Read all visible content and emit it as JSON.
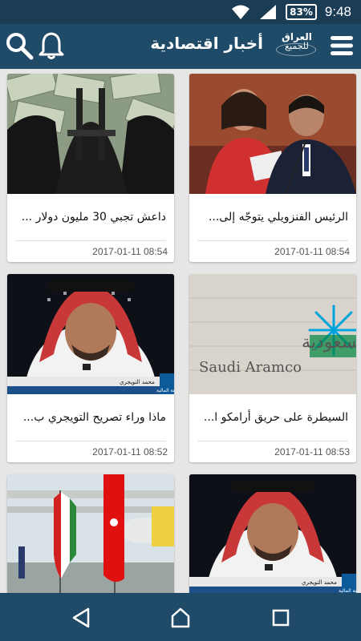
{
  "statusbar": {
    "battery": "83%",
    "time": "9:48"
  },
  "appbar": {
    "title": "أخبار اقتصادية",
    "logo_line1": "العراق",
    "logo_line2": "للجميع"
  },
  "cards": [
    {
      "title": "الرئيس الفنزويلي يتوجّه إلى...",
      "date": "2017-01-11 08:54"
    },
    {
      "title": "داعش تجبي 30 مليون دولار ...",
      "date": "2017-01-11 08:54"
    },
    {
      "title": "السيطرة على حريق أرامكو ا...",
      "date": "2017-01-11 08:53"
    },
    {
      "title": "ماذا وراء تصريح التويجري ب...",
      "date": "2017-01-11 08:52"
    }
  ],
  "images": {
    "aramco_text_ar": "ارامكو السعودية",
    "aramco_text_en": "Saudi Aramco",
    "tv_caption_name": "محمد التويجري",
    "tv_caption_role": "نائب وزير الاقتصاد والتخطيط وأمين عام اللجنة المالية"
  },
  "colors": {
    "appbar": "#1f4a68",
    "statusbar": "#1a3d55",
    "background": "#e6e6e6"
  }
}
